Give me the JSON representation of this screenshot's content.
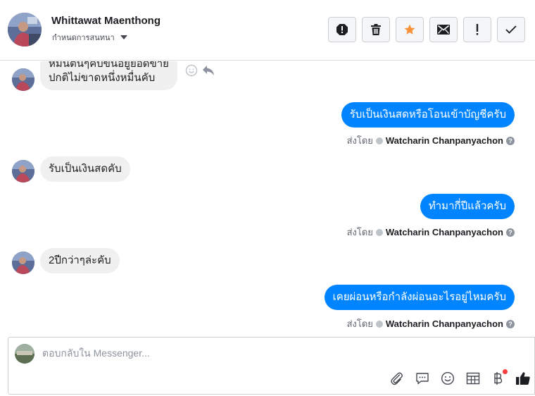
{
  "header": {
    "name": "Whittawat Maenthong",
    "subtitle": "กำหนดการสนทนา",
    "buttons": [
      {
        "icon": "alert-octagon-icon"
      },
      {
        "icon": "trash-icon"
      },
      {
        "icon": "star-icon",
        "color": "#f7923b"
      },
      {
        "icon": "envelope-icon"
      },
      {
        "icon": "exclamation-icon"
      },
      {
        "icon": "check-icon"
      }
    ]
  },
  "messages": [
    {
      "direction": "in",
      "lines": [
        "หมนตนๆคบขนอยูยอดขาย",
        "ปกติไม่ขาดหนึ่งหมื่นคับ"
      ]
    },
    {
      "direction": "out",
      "text": "รับเป็นเงินสดหรือโอนเข้าบัญชีครับ",
      "sent_by_label": "ส่งโดย",
      "sender": "Watcharin Chanpanyachon"
    },
    {
      "direction": "in",
      "text": "รับเป็นเงินสดคับ"
    },
    {
      "direction": "out",
      "text": "ทำมากี่ปีแล้วครับ",
      "sent_by_label": "ส่งโดย",
      "sender": "Watcharin Chanpanyachon"
    },
    {
      "direction": "in",
      "text": "2ปีกว่าๆล่ะคับ"
    },
    {
      "direction": "out",
      "text": "เคยผ่อนหรือกำลังผ่อนอะไรอยู่ไหมครับ",
      "sent_by_label": "ส่งโดย",
      "sender": "Watcharin Chanpanyachon"
    }
  ],
  "composer": {
    "placeholder": "ตอบกลับใน Messenger...",
    "tools": [
      "paperclip-icon",
      "chat-bubble-icon",
      "emoji-icon",
      "table-icon",
      "baht-icon",
      "thumbs-up-icon"
    ]
  },
  "colors": {
    "accent": "#0084ff",
    "incoming_bubble": "#f1f0f0",
    "star": "#f7923b",
    "notification": "#fa3e3e"
  }
}
